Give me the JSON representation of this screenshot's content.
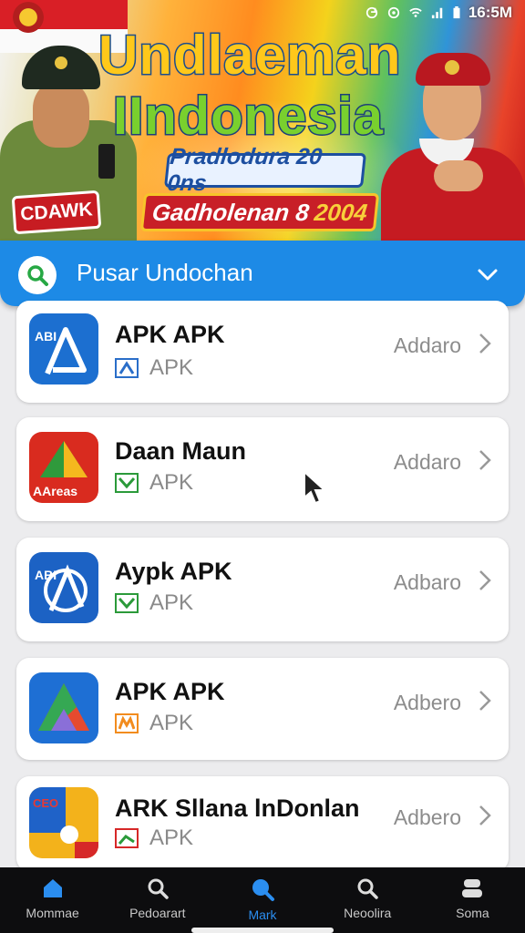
{
  "status_bar": {
    "time": "16:5M"
  },
  "banner": {
    "title_line1": "Undlaeman",
    "title_line2": "IIndonesia",
    "subtitle": "Pradlodura 20 0ns",
    "date_text": "Gadholenan 8",
    "date_year": "2004",
    "left_badge": "CDAWK",
    "colors": {
      "red": "#c81f27",
      "gold": "#ffc81a",
      "green": "#79d02e",
      "navy": "#1d4fa0"
    }
  },
  "search": {
    "label": "Pusar Undochan",
    "icon": "search-icon",
    "dropdown_icon": "chevron-down-icon",
    "accent": "#1d8ae6"
  },
  "apps": [
    {
      "name": "APK APK",
      "sub": "APK",
      "action": "Addaro",
      "icon_text": "ABI"
    },
    {
      "name": "Daan Maun",
      "sub": "APK",
      "action": "Addaro",
      "icon_text": "AAreas"
    },
    {
      "name": "Aypk APK",
      "sub": "APK",
      "action": "Adbaro",
      "icon_text": "ABI"
    },
    {
      "name": "APK APK",
      "sub": "APK",
      "action": "Adbero",
      "icon_text": ""
    },
    {
      "name": "ARK Sllana lnDonlan",
      "sub": "APK",
      "action": "Adbero",
      "icon_text": "CEO"
    }
  ],
  "nav": [
    {
      "label": "Mommae",
      "icon": "home-icon"
    },
    {
      "label": "Pedoarart",
      "icon": "search-icon"
    },
    {
      "label": "Mark",
      "icon": "search-icon",
      "active": true
    },
    {
      "label": "Neoolira",
      "icon": "search-icon"
    },
    {
      "label": "Soma",
      "icon": "profile-icon"
    }
  ]
}
